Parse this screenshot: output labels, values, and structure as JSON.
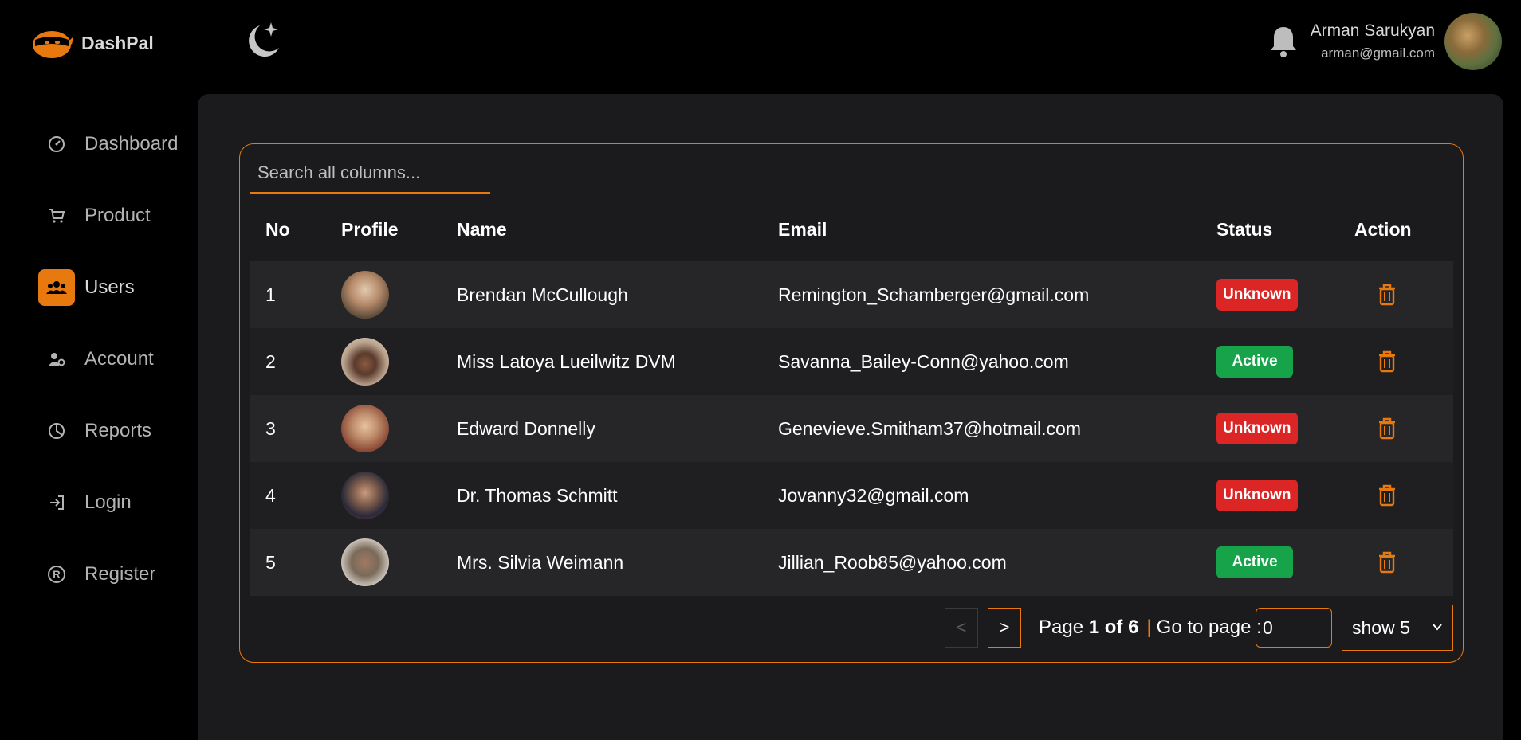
{
  "header": {
    "brand": "DashPal",
    "user_name": "Arman Sarukyan",
    "user_email": "arman@gmail.com"
  },
  "colors": {
    "accent": "#e8790f",
    "badge_unknown": "#dc2626",
    "badge_active": "#16a34a"
  },
  "sidebar": {
    "items": [
      {
        "label": "Dashboard",
        "icon": "gauge-icon"
      },
      {
        "label": "Product",
        "icon": "cart-icon"
      },
      {
        "label": "Users",
        "icon": "users-icon",
        "active": true
      },
      {
        "label": "Account",
        "icon": "user-gear-icon"
      },
      {
        "label": "Reports",
        "icon": "pie-chart-icon"
      },
      {
        "label": "Login",
        "icon": "login-icon"
      },
      {
        "label": "Register",
        "icon": "registered-icon"
      }
    ]
  },
  "table": {
    "search_placeholder": "Search all columns...",
    "columns": [
      "No",
      "Profile",
      "Name",
      "Email",
      "Status",
      "Action"
    ],
    "rows": [
      {
        "no": "1",
        "name": "Brendan McCullough",
        "email": "Remington_Schamberger@gmail.com",
        "status": "Unknown"
      },
      {
        "no": "2",
        "name": "Miss Latoya Lueilwitz DVM",
        "email": "Savanna_Bailey-Conn@yahoo.com",
        "status": "Active"
      },
      {
        "no": "3",
        "name": "Edward Donnelly",
        "email": "Genevieve.Smitham37@hotmail.com",
        "status": "Unknown"
      },
      {
        "no": "4",
        "name": "Dr. Thomas Schmitt",
        "email": "Jovanny32@gmail.com",
        "status": "Unknown"
      },
      {
        "no": "5",
        "name": "Mrs. Silvia Weimann",
        "email": "Jillian_Roob85@yahoo.com",
        "status": "Active"
      }
    ]
  },
  "pagination": {
    "prev_label": "<",
    "next_label": ">",
    "page_word": "Page",
    "page_of": "1 of 6",
    "separator": "|",
    "goto_label": "Go to page :",
    "goto_value": "0",
    "show_label": "show 5"
  }
}
